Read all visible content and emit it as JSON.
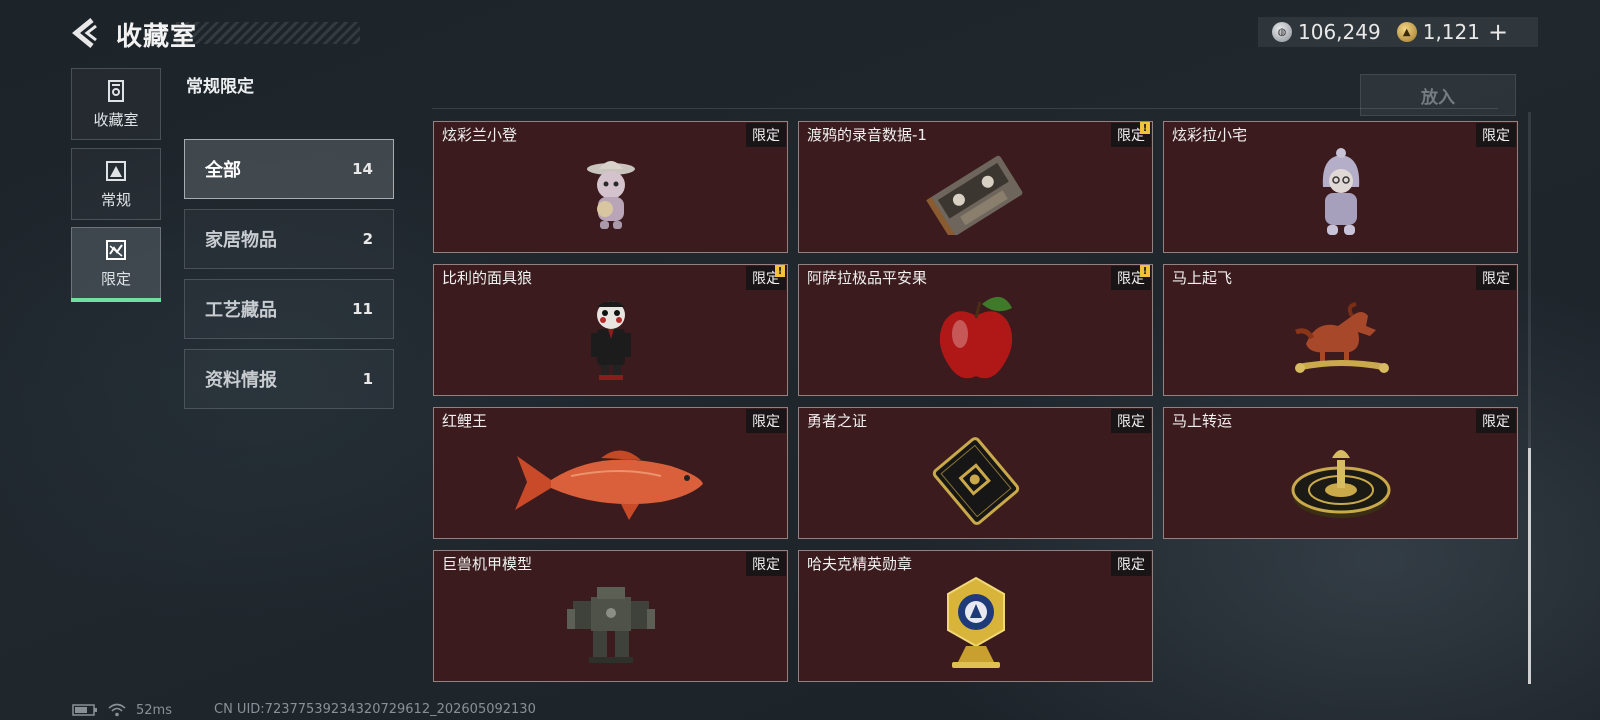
{
  "header": {
    "title": "收藏室",
    "currency": [
      {
        "icon": "silver-coin-icon",
        "value": "106,249"
      },
      {
        "icon": "gold-coin-icon",
        "value": "1,121"
      }
    ],
    "add_label": "+"
  },
  "nav": [
    {
      "icon": "collection-room-icon",
      "label": "收藏室"
    },
    {
      "icon": "regular-icon",
      "label": "常规"
    },
    {
      "icon": "limited-icon",
      "label": "限定",
      "active": true
    }
  ],
  "section": {
    "title": "常规限定"
  },
  "categories": [
    {
      "label": "全部",
      "count": "14",
      "active": true
    },
    {
      "label": "家居物品",
      "count": "2"
    },
    {
      "label": "工艺藏品",
      "count": "11"
    },
    {
      "label": "资料情报",
      "count": "1"
    }
  ],
  "place_button": "放入",
  "items": [
    {
      "name": "炫彩兰小登",
      "badge": "限定",
      "warning": false,
      "image": "figurine-sombrero"
    },
    {
      "name": "渡鸦的录音数据-1",
      "badge": "限定",
      "warning": true,
      "image": "cassette-tape"
    },
    {
      "name": "炫彩拉小宅",
      "badge": "限定",
      "warning": false,
      "image": "figurine-hood"
    },
    {
      "name": "比利的面具狼",
      "badge": "限定",
      "warning": true,
      "image": "puppet-figure"
    },
    {
      "name": "阿萨拉极品平安果",
      "badge": "限定",
      "warning": true,
      "image": "red-apple"
    },
    {
      "name": "马上起飞",
      "badge": "限定",
      "warning": false,
      "image": "horse-sculpture"
    },
    {
      "name": "红鲤王",
      "badge": "限定",
      "warning": false,
      "image": "red-carp"
    },
    {
      "name": "勇者之证",
      "badge": "限定",
      "warning": false,
      "image": "black-card"
    },
    {
      "name": "马上转运",
      "badge": "限定",
      "warning": false,
      "image": "golden-roulette"
    },
    {
      "name": "巨兽机甲模型",
      "badge": "限定",
      "warning": false,
      "image": "mech-model"
    },
    {
      "name": "哈夫克精英勋章",
      "badge": "限定",
      "warning": false,
      "image": "elite-medal"
    }
  ],
  "warn_mark": "!",
  "status": {
    "ping": "52ms",
    "uid": "CN UID:7237753923432072961​2_202605092130"
  }
}
